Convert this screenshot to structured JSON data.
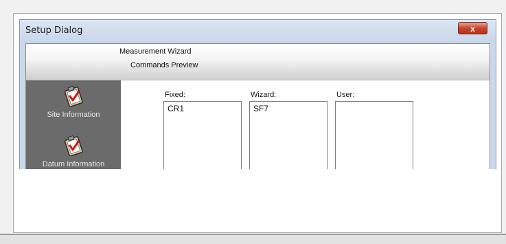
{
  "dialog": {
    "title": "Setup Dialog",
    "close_label": "x"
  },
  "header": {
    "title": "Measurement Wizard",
    "subtitle": "Commands Preview"
  },
  "sidebar": {
    "items": [
      {
        "label": "Site Information"
      },
      {
        "label": "Datum Information"
      }
    ]
  },
  "commands": {
    "fixed": {
      "label": "Fixed:",
      "value": "CR1"
    },
    "wizard": {
      "label": "Wizard:",
      "value": "SF7"
    },
    "user": {
      "label": "User:",
      "value": ""
    }
  }
}
